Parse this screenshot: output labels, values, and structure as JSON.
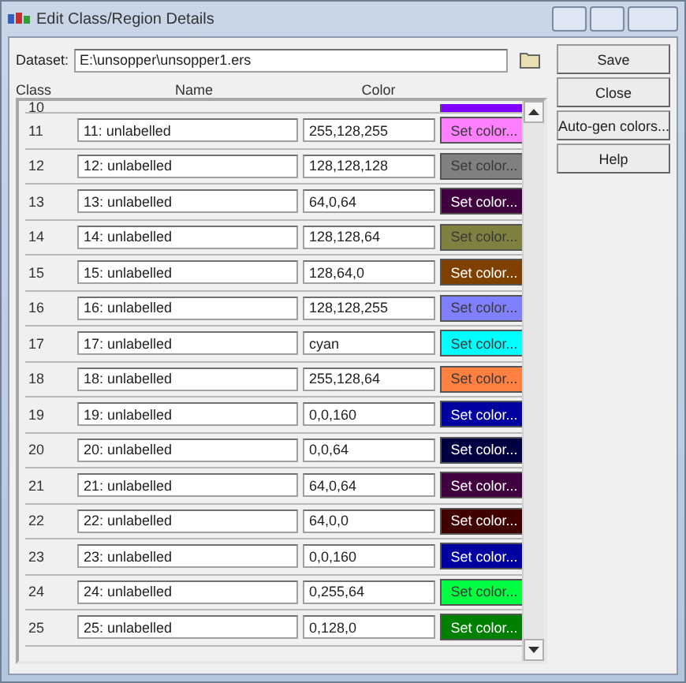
{
  "window": {
    "title": "Edit Class/Region Details"
  },
  "dataset": {
    "label": "Dataset:",
    "value": "E:\\unsopper\\unsopper1.ers"
  },
  "columns": [
    "Class",
    "Name",
    "Color"
  ],
  "partial_row": {
    "class": "10",
    "color": "#8000ff"
  },
  "rows": [
    {
      "class": "11",
      "name": "11: unlabelled",
      "value": "255,128,255",
      "button": "Set color...",
      "color": "#ff80ff"
    },
    {
      "class": "12",
      "name": "12: unlabelled",
      "value": "128,128,128",
      "button": "Set color...",
      "color": "#808080"
    },
    {
      "class": "13",
      "name": "13: unlabelled",
      "value": "64,0,64",
      "button": "Set color...",
      "color": "#400040"
    },
    {
      "class": "14",
      "name": "14: unlabelled",
      "value": "128,128,64",
      "button": "Set color...",
      "color": "#808040"
    },
    {
      "class": "15",
      "name": "15: unlabelled",
      "value": "128,64,0",
      "button": "Set color...",
      "color": "#804000"
    },
    {
      "class": "16",
      "name": "16: unlabelled",
      "value": "128,128,255",
      "button": "Set color...",
      "color": "#8080ff"
    },
    {
      "class": "17",
      "name": "17: unlabelled",
      "value": "cyan",
      "button": "Set color...",
      "color": "#00ffff"
    },
    {
      "class": "18",
      "name": "18: unlabelled",
      "value": "255,128,64",
      "button": "Set color...",
      "color": "#ff8040"
    },
    {
      "class": "19",
      "name": "19: unlabelled",
      "value": "0,0,160",
      "button": "Set color...",
      "color": "#0000a0"
    },
    {
      "class": "20",
      "name": "20: unlabelled",
      "value": "0,0,64",
      "button": "Set color...",
      "color": "#000040"
    },
    {
      "class": "21",
      "name": "21: unlabelled",
      "value": "64,0,64",
      "button": "Set color...",
      "color": "#400040"
    },
    {
      "class": "22",
      "name": "22: unlabelled",
      "value": "64,0,0",
      "button": "Set color...",
      "color": "#400000"
    },
    {
      "class": "23",
      "name": "23: unlabelled",
      "value": "0,0,160",
      "button": "Set color...",
      "color": "#0000a0"
    },
    {
      "class": "24",
      "name": "24: unlabelled",
      "value": "0,255,64",
      "button": "Set color...",
      "color": "#00ff40"
    },
    {
      "class": "25",
      "name": "25: unlabelled",
      "value": "0,128,0",
      "button": "Set color...",
      "color": "#008000"
    }
  ],
  "buttons": [
    "Save",
    "Close",
    "Auto-gen colors...",
    "Help"
  ]
}
